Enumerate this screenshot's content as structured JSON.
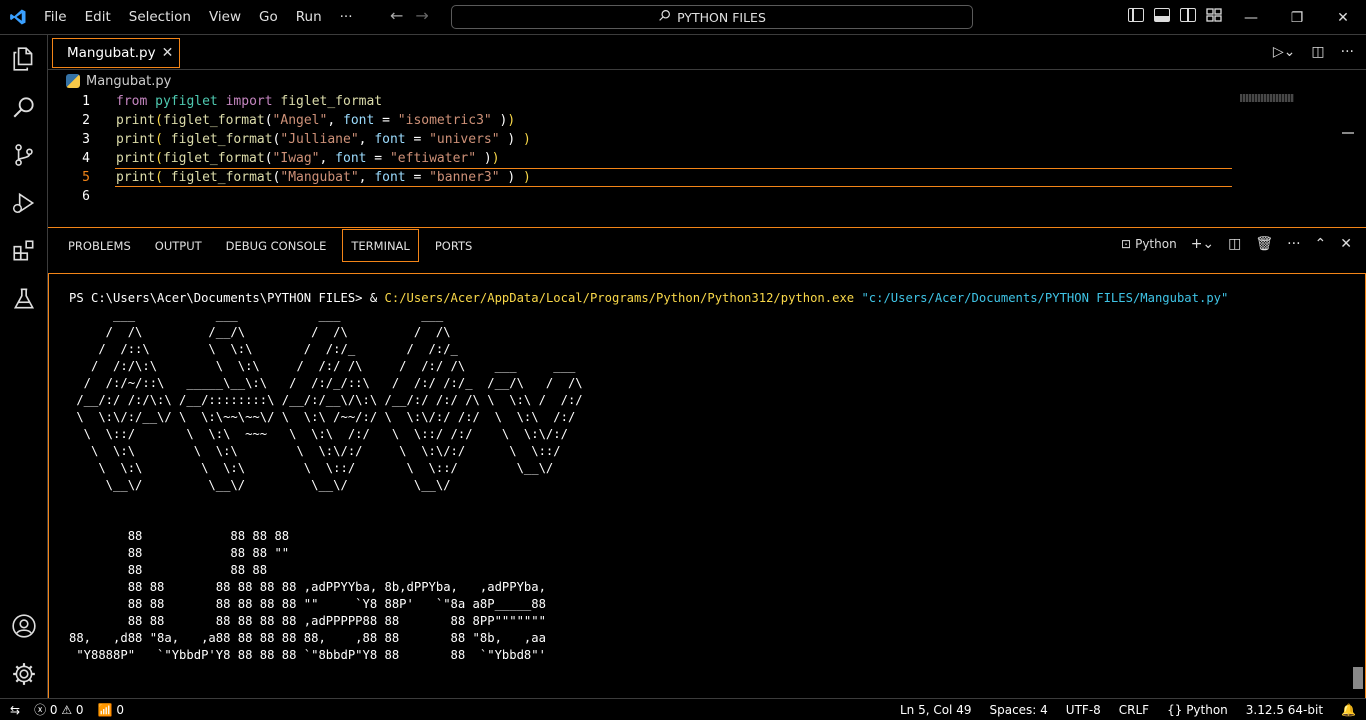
{
  "menu": [
    "File",
    "Edit",
    "Selection",
    "View",
    "Go",
    "Run",
    "···"
  ],
  "search": {
    "label": "PYTHON FILES"
  },
  "tab": {
    "filename": "Mangubat.py"
  },
  "breadcrumb": {
    "file": "Mangubat.py"
  },
  "editor": {
    "line_numbers": [
      "1",
      "2",
      "3",
      "4",
      "5",
      "6"
    ],
    "active_line": 5
  },
  "panel": {
    "tabs": [
      "PROBLEMS",
      "OUTPUT",
      "DEBUG CONSOLE",
      "TERMINAL",
      "PORTS"
    ],
    "active_tab": "TERMINAL",
    "terminal_profile": "Python"
  },
  "terminal": {
    "prompt": "PS C:\\Users\\Acer\\Documents\\PYTHON FILES> & ",
    "exe": "C:/Users/Acer/AppData/Local/Programs/Python/Python312/python.exe",
    "arg": " \"c:/Users/Acer/Documents/PYTHON FILES/Mangubat.py\"",
    "output": "      ___           ___           ___           ___\n     /  /\\         /__/\\         /  /\\         /  /\\\n    /  /::\\        \\  \\:\\       /  /:/_       /  /:/_\n   /  /:/\\:\\        \\  \\:\\     /  /:/ /\\     /  /:/ /\\    ___     ___\n  /  /:/~/::\\   _____\\__\\:\\   /  /:/_/::\\   /  /:/ /:/_  /__/\\   /  /\\\n /__/:/ /:/\\:\\ /__/::::::::\\ /__/:/__\\/\\:\\ /__/:/ /:/ /\\ \\  \\:\\ /  /:/\n \\  \\:\\/:/__\\/ \\  \\:\\~~\\~~\\/ \\  \\:\\ /~~/:/ \\  \\:\\/:/ /:/  \\  \\:\\  /:/\n  \\  \\::/       \\  \\:\\  ~~~   \\  \\:\\  /:/   \\  \\::/ /:/    \\  \\:\\/:/\n   \\  \\:\\        \\  \\:\\        \\  \\:\\/:/     \\  \\:\\/:/      \\  \\::/\n    \\  \\:\\        \\  \\:\\        \\  \\::/       \\  \\::/        \\__\\/\n     \\__\\/         \\__\\/         \\__\\/         \\__\\/\n\n\n        88            88 88 88\n        88            88 88 \"\"\n        88            88 88\n        88 88       88 88 88 88 ,adPPYYba, 8b,dPPYba,   ,adPPYba,\n        88 88       88 88 88 88 \"\"     `Y8 88P'   `\"8a a8P_____88\n        88 88       88 88 88 88 ,adPPPPP88 88       88 8PP\"\"\"\"\"\"\"\n88,   ,d88 \"8a,   ,a88 88 88 88 88,    ,88 88       88 \"8b,   ,aa\n \"Y8888P\"   `\"YbbdP'Y8 88 88 88 `\"8bbdP\"Y8 88       88  `\"Ybbd8\"'"
  },
  "status": {
    "errors": "0",
    "warnings": "0",
    "ports": "0",
    "position": "Ln 5, Col 49",
    "spaces": "Spaces: 4",
    "encoding": "UTF-8",
    "eol": "CRLF",
    "language": "Python",
    "interpreter": "3.12.5 64-bit"
  },
  "colors": {
    "accent": "#f38518",
    "keyword": "#c586c0",
    "string": "#ce9178",
    "param": "#9cdcfe",
    "function": "#dcdcaa"
  }
}
